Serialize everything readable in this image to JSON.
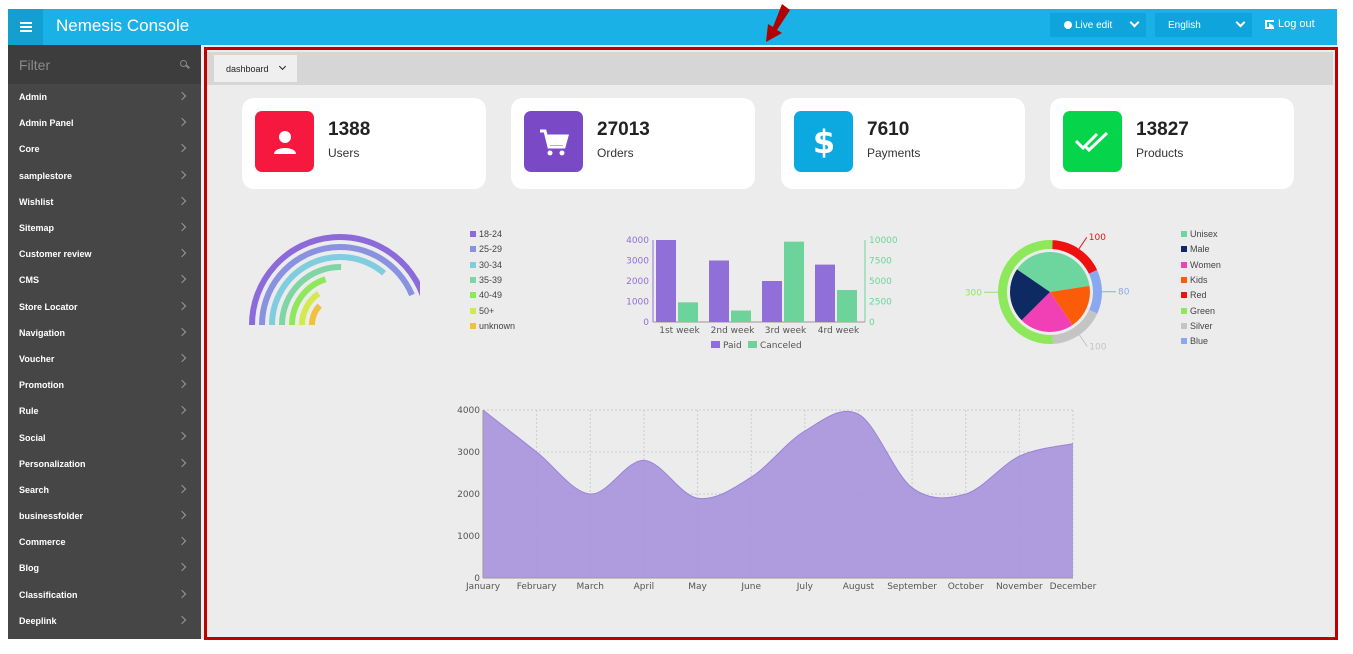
{
  "header": {
    "brand": "Nemesis Console",
    "live_edit": "Live edit",
    "language": "English",
    "logout": "Log out"
  },
  "sidebar": {
    "filter_placeholder": "Filter",
    "items": [
      "Admin",
      "Admin Panel",
      "Core",
      "samplestore",
      "Wishlist",
      "Sitemap",
      "Customer review",
      "CMS",
      "Store Locator",
      "Navigation",
      "Voucher",
      "Promotion",
      "Rule",
      "Social",
      "Personalization",
      "Search",
      "businessfolder",
      "Commerce",
      "Blog",
      "Classification",
      "Deeplink"
    ]
  },
  "tab": {
    "label": "dashboard"
  },
  "cards": [
    {
      "value": "1388",
      "label": "Users",
      "icon": "user-icon",
      "color": "#f6183f"
    },
    {
      "value": "27013",
      "label": "Orders",
      "icon": "cart-icon",
      "color": "#7a4ac6"
    },
    {
      "value": "7610",
      "label": "Payments",
      "icon": "dollar-icon",
      "color": "#0ca8e0"
    },
    {
      "value": "13827",
      "label": "Products",
      "icon": "double-check-icon",
      "color": "#06d44a"
    }
  ],
  "chart_data": [
    {
      "type": "radial-bar",
      "categories": [
        "18-24",
        "25-29",
        "30-34",
        "35-39",
        "40-49",
        "50+",
        "unknown"
      ],
      "colors": [
        "#8c6ad9",
        "#8892e0",
        "#80cde0",
        "#7fd5a3",
        "#8ee85c",
        "#d4e84f",
        "#f0c040"
      ],
      "values": [
        0.82,
        0.76,
        0.63,
        0.44,
        0.35,
        0.27,
        0.21
      ]
    },
    {
      "type": "bar",
      "categories": [
        "1st week",
        "2nd week",
        "3rd week",
        "4rd week"
      ],
      "series": [
        {
          "name": "Paid",
          "axis": "left",
          "color": "#9070d8",
          "values": [
            4000,
            3000,
            2000,
            2800
          ]
        },
        {
          "name": "Canceled",
          "axis": "right",
          "color": "#6cd49a",
          "values": [
            2400,
            1400,
            9800,
            3900
          ]
        }
      ],
      "yleft_ticks": [
        "0",
        "1000",
        "2000",
        "3000",
        "4000"
      ],
      "yright_ticks": [
        "0",
        "2500",
        "5000",
        "7500",
        "10000"
      ],
      "yleft_lim": [
        0,
        4000
      ],
      "yright_lim": [
        0,
        10000
      ]
    },
    {
      "type": "pie",
      "inner": {
        "categories": [
          "Unisex",
          "Male",
          "Women",
          "Kids"
        ],
        "colors": [
          "#6cd69e",
          "#0d2a63",
          "#f13fb6",
          "#fb5c0a"
        ],
        "values": [
          38,
          22,
          22,
          18
        ]
      },
      "outer": {
        "categories": [
          "Red",
          "Blue",
          "Silver",
          "Green"
        ],
        "colors": [
          "#ee1111",
          "#8aa8ef",
          "#c4c4c4",
          "#8ee85c"
        ],
        "values": [
          100,
          80,
          100,
          300
        ],
        "labels": [
          "100",
          "80",
          "100",
          "300"
        ]
      },
      "legend": [
        "Unisex",
        "Male",
        "Women",
        "Kids",
        "Red",
        "Green",
        "Silver",
        "Blue"
      ],
      "legend_colors": [
        "#6cd69e",
        "#0d2a63",
        "#f13fb6",
        "#fb5c0a",
        "#ee1111",
        "#8ee85c",
        "#c4c4c4",
        "#8aa8ef"
      ]
    },
    {
      "type": "area",
      "categories": [
        "January",
        "February",
        "March",
        "April",
        "May",
        "June",
        "July",
        "August",
        "September",
        "October",
        "November",
        "December"
      ],
      "values": [
        4000,
        3000,
        2000,
        2800,
        1900,
        2400,
        3500,
        3900,
        2150,
        2000,
        2900,
        3200
      ],
      "yticks": [
        "0",
        "1000",
        "2000",
        "3000",
        "4000"
      ],
      "ylim": [
        0,
        4000
      ],
      "color": "#a58edd",
      "grid": true
    }
  ]
}
